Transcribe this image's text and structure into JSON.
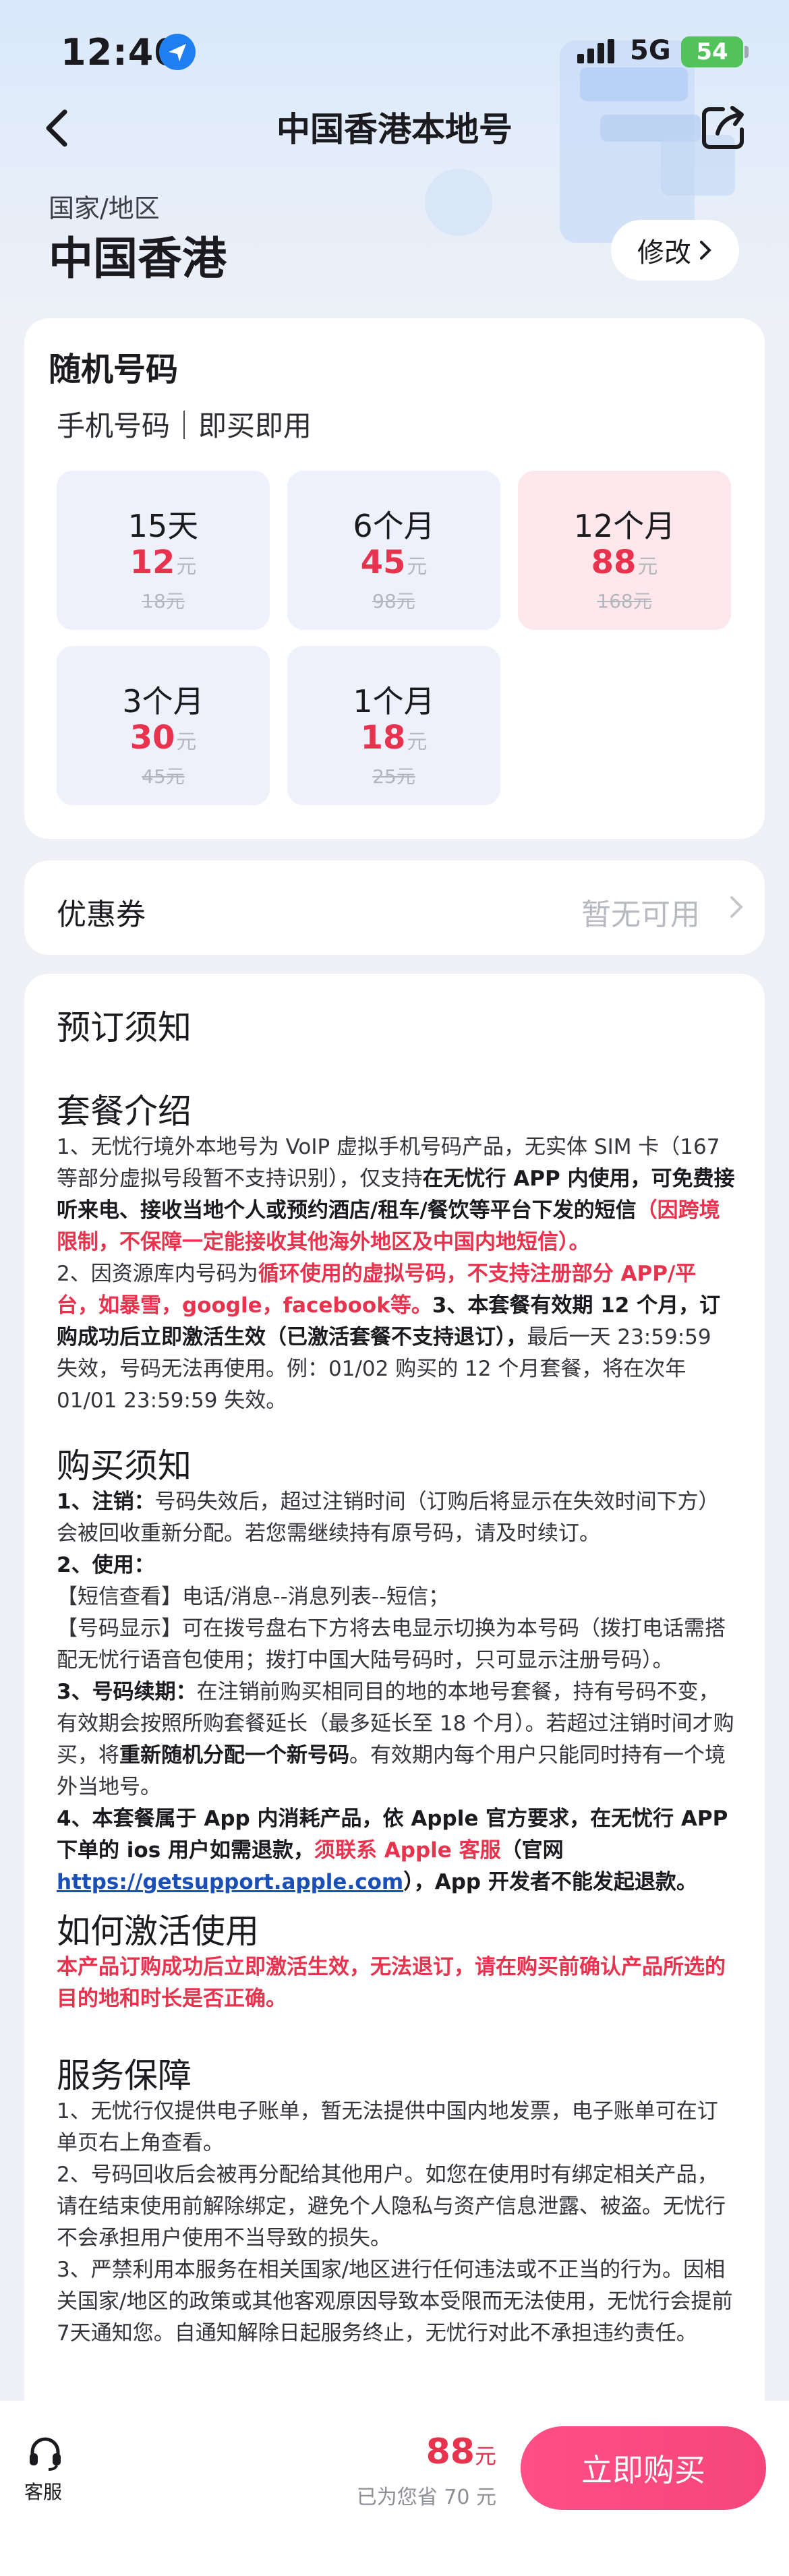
{
  "status": {
    "time": "12:40",
    "network": "5G",
    "battery": "54"
  },
  "nav": {
    "title": "中国香港本地号"
  },
  "region": {
    "label": "国家/地区",
    "value": "中国香港",
    "edit": "修改"
  },
  "plans": {
    "title": "随机号码",
    "subtitle": "手机号码｜即买即用",
    "items": [
      {
        "duration": "15天",
        "price": "12",
        "unit": "元",
        "original": "18元"
      },
      {
        "duration": "6个月",
        "price": "45",
        "unit": "元",
        "original": "98元"
      },
      {
        "duration": "12个月",
        "price": "88",
        "unit": "元",
        "original": "168元",
        "selected": true
      },
      {
        "duration": "3个月",
        "price": "30",
        "unit": "元",
        "original": "45元"
      },
      {
        "duration": "1个月",
        "price": "18",
        "unit": "元",
        "original": "25元"
      }
    ]
  },
  "coupon": {
    "label": "优惠券",
    "value": "暂无可用"
  },
  "notes": {
    "title": "预订须知",
    "package_title": "套餐介绍",
    "package_p1a": "1、无忧行境外本地号为 VoIP 虚拟手机号码产品，无实体 SIM 卡（167等部分虚拟号段暂不支持识别），仅支持",
    "package_p1b": "在无忧行 APP 内使用，可免费接听来电、接收当地个人或预约酒店/租车/餐饮等平台下发的短信",
    "package_p1c": "（因跨境限制，不保障一定能接收其他海外地区及中国内地短信）。",
    "package_p2a": "2、因资源库内号码为",
    "package_p2b": "循环使用的虚拟号码，不支持注册部分 APP/平台，如暴雪，google，facebook等。",
    "package_p2c": "3、本套餐有效期 12 个月，订购成功后立即激活生效（已激活套餐不支持退订），",
    "package_p2d": "最后一天 23:59:59 失效，号码无法再使用。例：01/02 购买的 12 个月套餐，将在次年 01/01 23:59:59 失效。",
    "purchase_title": "购买须知",
    "purchase_1a": "1、注销：",
    "purchase_1b": "号码失效后，超过注销时间（订购后将显示在失效时间下方）会被回收重新分配。若您需继续持有原号码，请及时续订。",
    "purchase_2": "2、使用：",
    "purchase_2a": "【短信查看】电话/消息--消息列表--短信；",
    "purchase_2b": "【号码显示】可在拨号盘右下方将去电显示切换为本号码（拨打电话需搭配无忧行语音包使用；拨打中国大陆号码时，只可显示注册号码）。",
    "purchase_3a": "3、号码续期：",
    "purchase_3b": "在注销前购买相同目的地的本地号套餐，持有号码不变，有效期会按照所购套餐延长（最多延长至 18 个月）。若超过注销时间才购买，将",
    "purchase_3c": "重新随机分配一个新号码",
    "purchase_3d": "。有效期内每个用户只能同时持有一个境外当地号。",
    "purchase_4a": "4、本套餐属于 App 内消耗产品，依 Apple 官方要求，在无忧行 APP 下单的 ios 用户如需退款，",
    "purchase_4b": "须联系 Apple 客服",
    "purchase_4c": "（官网 ",
    "purchase_4link": "https://getsupport.apple.com",
    "purchase_4d": "），App 开发者不能发起退款。",
    "activate_title": "如何激活使用",
    "activate_text": "本产品订购成功后立即激活生效，无法退订，请在购买前确认产品所选的目的地和时长是否正确。",
    "service_title": "服务保障",
    "service_1": "1、无忧行仅提供电子账单，暂无法提供中国内地发票，电子账单可在订单页右上角查看。",
    "service_2": "2、号码回收后会被再分配给其他用户。如您在使用时有绑定相关产品，请在结束使用前解除绑定，避免个人隐私与资产信息泄露、被盗。无忧行不会承担用户使用不当导致的损失。",
    "service_3": "3、严禁利用本服务在相关国家/地区进行任何违法或不正当的行为。因相关国家/地区的政策或其他客观原因导致本受限而无法使用，无忧行会提前7天通知您。自通知解除日起服务终止，无忧行对此不承担违约责任。"
  },
  "bottom": {
    "service_label": "客服",
    "total_price": "88",
    "total_unit": "元",
    "saved": "已为您省 70 元",
    "buy": "立即购买"
  },
  "colors": {
    "accent": "#e8334e",
    "button": "#f5467b",
    "selected_bg": "#fce7ec",
    "plan_bg": "#eef1fb"
  }
}
